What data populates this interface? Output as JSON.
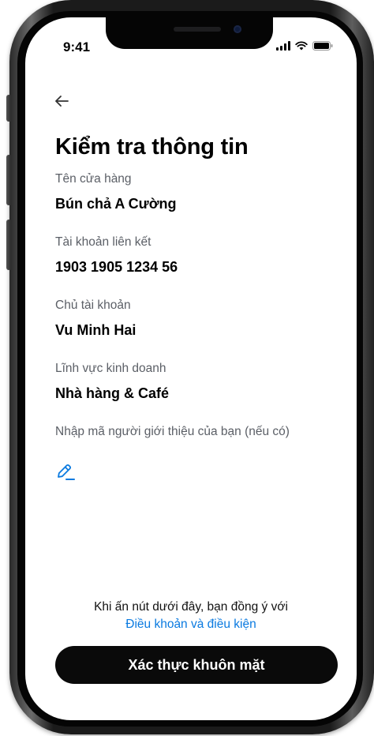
{
  "status_bar": {
    "time": "9:41",
    "icons": [
      "signal-icon",
      "wifi-icon",
      "battery-icon"
    ]
  },
  "header": {
    "back_icon": "back-arrow-icon",
    "title": "Kiểm tra thông tin"
  },
  "fields": [
    {
      "label": "Tên cửa hàng",
      "value": "Bún chả A Cường"
    },
    {
      "label": "Tài khoản liên kết",
      "value": "1903 1905 1234 56"
    },
    {
      "label": "Chủ tài khoản",
      "value": "Vu Minh Hai"
    },
    {
      "label": "Lĩnh vực kinh doanh",
      "value": "Nhà hàng & Café"
    }
  ],
  "referral": {
    "label": "Nhập mã người giới thiệu của bạn (nếu có)",
    "edit_icon": "pencil-icon"
  },
  "footer": {
    "agreement_text": "Khi ấn nút dưới đây, bạn đồng ý với",
    "terms_link": "Điều khoản và điều kiện",
    "cta_label": "Xác thực khuôn mặt"
  },
  "colors": {
    "link": "#0a7ae0",
    "cta_bg": "#0a0a0a",
    "label": "#5b5f66"
  }
}
